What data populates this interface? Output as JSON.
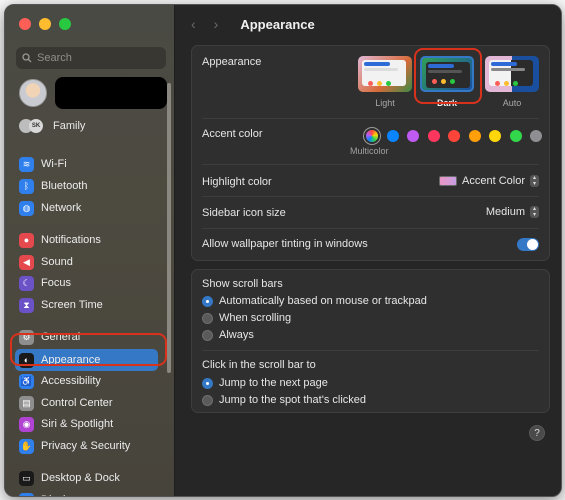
{
  "window": {
    "title": "Appearance"
  },
  "sidebar": {
    "search_placeholder": "Search",
    "family_label": "Family",
    "family_initials": "SK",
    "items": [
      {
        "label": "Wi-Fi",
        "icon": "wifi-icon",
        "color": "#2f80ed"
      },
      {
        "label": "Bluetooth",
        "icon": "bluetooth-icon",
        "color": "#2f80ed"
      },
      {
        "label": "Network",
        "icon": "globe-icon",
        "color": "#2f80ed"
      },
      {
        "label": "Notifications",
        "icon": "bell-icon",
        "color": "#e5484d"
      },
      {
        "label": "Sound",
        "icon": "speaker-icon",
        "color": "#e5484d"
      },
      {
        "label": "Focus",
        "icon": "moon-icon",
        "color": "#6b52c7"
      },
      {
        "label": "Screen Time",
        "icon": "hourglass-icon",
        "color": "#6b52c7"
      },
      {
        "label": "General",
        "icon": "gear-icon",
        "color": "#8e8e8e"
      },
      {
        "label": "Appearance",
        "icon": "appearance-icon",
        "color": "#1a1a1a"
      },
      {
        "label": "Accessibility",
        "icon": "accessibility-icon",
        "color": "#2f80ed"
      },
      {
        "label": "Control Center",
        "icon": "control-center-icon",
        "color": "#8e8e8e"
      },
      {
        "label": "Siri & Spotlight",
        "icon": "siri-icon",
        "color": "#b043d1"
      },
      {
        "label": "Privacy & Security",
        "icon": "hand-icon",
        "color": "#2f80ed"
      },
      {
        "label": "Desktop & Dock",
        "icon": "dock-icon",
        "color": "#1a1a1a"
      },
      {
        "label": "Displays",
        "icon": "display-icon",
        "color": "#2f80ed"
      }
    ],
    "selected": "Appearance"
  },
  "appearance": {
    "row_label": "Appearance",
    "options": [
      {
        "label": "Light",
        "selected": false
      },
      {
        "label": "Dark",
        "selected": true
      },
      {
        "label": "Auto",
        "selected": false
      }
    ],
    "accent_label": "Accent color",
    "accent_caption": "Multicolor",
    "accent_colors": [
      "multicolor",
      "#0a84ff",
      "#bf5af2",
      "#ff375f",
      "#ff453a",
      "#ff9f0a",
      "#ffd60a",
      "#32d74b",
      "#8e8e93"
    ],
    "highlight_label": "Highlight color",
    "highlight_value": "Accent Color",
    "icon_size_label": "Sidebar icon size",
    "icon_size_value": "Medium",
    "tinting_label": "Allow wallpaper tinting in windows",
    "tinting_on": true
  },
  "scrollbars": {
    "show_label": "Show scroll bars",
    "show_options": [
      {
        "label": "Automatically based on mouse or trackpad",
        "selected": true
      },
      {
        "label": "When scrolling",
        "selected": false
      },
      {
        "label": "Always",
        "selected": false
      }
    ],
    "click_label": "Click in the scroll bar to",
    "click_options": [
      {
        "label": "Jump to the next page",
        "selected": true
      },
      {
        "label": "Jump to the spot that's clicked",
        "selected": false
      }
    ]
  },
  "help_label": "?"
}
